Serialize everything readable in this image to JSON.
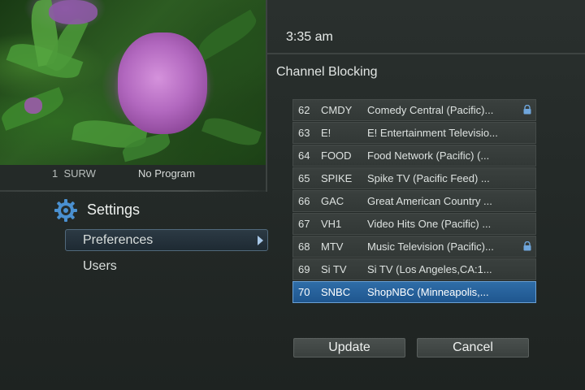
{
  "header": {
    "clock": "3:35 am"
  },
  "preview": {
    "channel_number": "1",
    "channel_callsign": "SURW",
    "program": "No Program"
  },
  "sidebar": {
    "title": "Settings",
    "items": [
      {
        "label": "Preferences",
        "selected": true
      },
      {
        "label": "Users",
        "selected": false
      }
    ]
  },
  "main": {
    "section_title": "Channel Blocking",
    "channels": [
      {
        "number": "62",
        "callsign": "CMDY",
        "name": "Comedy Central (Pacific)...",
        "locked": true,
        "selected": false
      },
      {
        "number": "63",
        "callsign": "E!",
        "name": "E! Entertainment Televisio...",
        "locked": false,
        "selected": false
      },
      {
        "number": "64",
        "callsign": "FOOD",
        "name": "Food Network (Pacific) (...",
        "locked": false,
        "selected": false
      },
      {
        "number": "65",
        "callsign": "SPIKE",
        "name": "Spike TV (Pacific Feed) ...",
        "locked": false,
        "selected": false
      },
      {
        "number": "66",
        "callsign": "GAC",
        "name": "Great American Country ...",
        "locked": false,
        "selected": false
      },
      {
        "number": "67",
        "callsign": "VH1",
        "name": "Video Hits One (Pacific) ...",
        "locked": false,
        "selected": false
      },
      {
        "number": "68",
        "callsign": "MTV",
        "name": "Music Television (Pacific)...",
        "locked": true,
        "selected": false
      },
      {
        "number": "69",
        "callsign": "Si TV",
        "name": "Si TV (Los Angeles,CA:1...",
        "locked": false,
        "selected": false
      },
      {
        "number": "70",
        "callsign": "SNBC",
        "name": "ShopNBC (Minneapolis,...",
        "locked": false,
        "selected": true
      }
    ],
    "buttons": {
      "update": "Update",
      "cancel": "Cancel"
    }
  },
  "colors": {
    "accent_selected": "#2f6da8",
    "background": "#242a28",
    "icon_blue": "#4a90d0"
  }
}
